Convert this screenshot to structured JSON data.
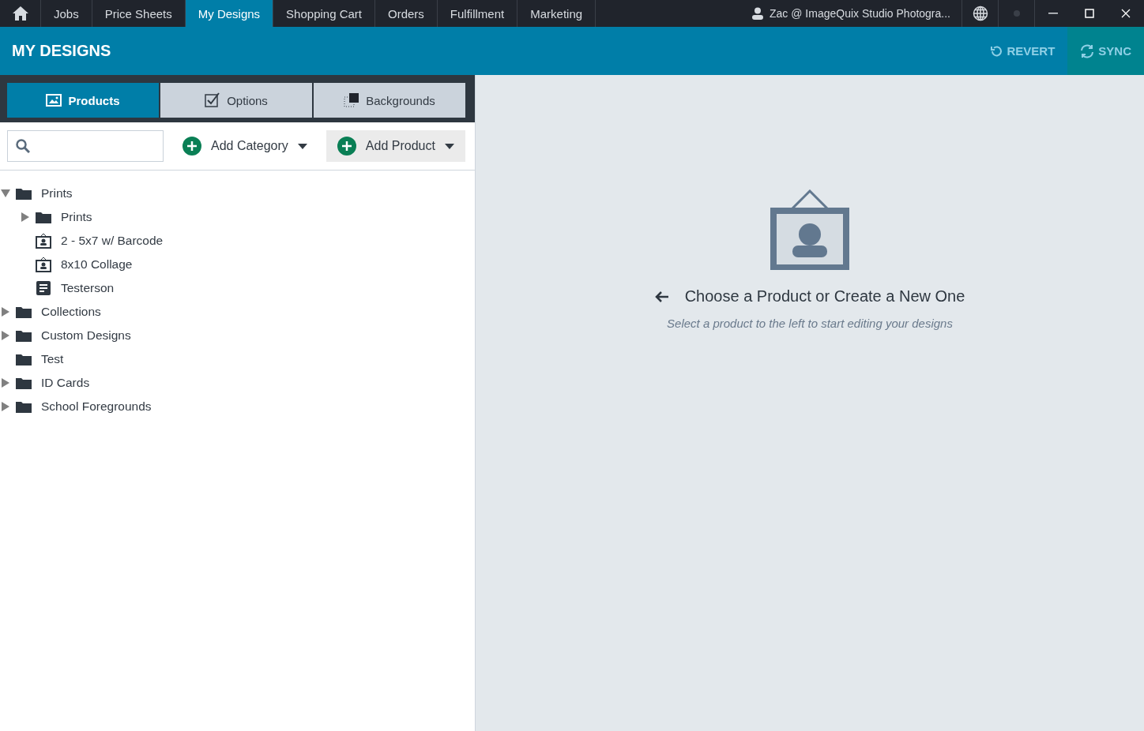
{
  "nav": {
    "tabs": [
      {
        "label": "Jobs",
        "selected": false
      },
      {
        "label": "Price Sheets",
        "selected": false
      },
      {
        "label": "My Designs",
        "selected": true
      },
      {
        "label": "Shopping Cart",
        "selected": false
      },
      {
        "label": "Orders",
        "selected": false
      },
      {
        "label": "Fulfillment",
        "selected": false
      },
      {
        "label": "Marketing",
        "selected": false
      }
    ],
    "user": "Zac @ ImageQuix Studio Photogra..."
  },
  "header": {
    "title": "MY DESIGNS",
    "actions": [
      {
        "kind": "revert",
        "label": "REVERT",
        "disabled": true
      },
      {
        "kind": "sync",
        "label": "SYNC",
        "disabled": true
      }
    ]
  },
  "panel_tabs": [
    {
      "kind": "products",
      "label": "Products",
      "selected": true
    },
    {
      "kind": "options",
      "label": "Options",
      "selected": false
    },
    {
      "kind": "backgrounds",
      "label": "Backgrounds",
      "selected": false
    }
  ],
  "toolbar": {
    "add_category": "Add Category",
    "add_product": "Add Product"
  },
  "tree": [
    {
      "kind": "folder",
      "label": "Prints",
      "expandable": true,
      "expanded": true,
      "children": [
        {
          "kind": "folder",
          "label": "Prints",
          "expandable": true,
          "expanded": false
        },
        {
          "kind": "product",
          "label": "2 - 5x7 w/ Barcode",
          "expandable": false
        },
        {
          "kind": "product",
          "label": "8x10 Collage",
          "expandable": false
        },
        {
          "kind": "document",
          "label": "Testerson",
          "expandable": false
        }
      ]
    },
    {
      "kind": "folder",
      "label": "Collections",
      "expandable": true,
      "expanded": false
    },
    {
      "kind": "folder",
      "label": "Custom Designs",
      "expandable": true,
      "expanded": false
    },
    {
      "kind": "folder",
      "label": "Test",
      "expandable": false
    },
    {
      "kind": "folder",
      "label": "ID Cards",
      "expandable": true,
      "expanded": false
    },
    {
      "kind": "folder",
      "label": "School Foregrounds",
      "expandable": true,
      "expanded": false
    }
  ],
  "empty_state": {
    "title": "Choose a Product or Create a New One",
    "subtitle": "Select a product to the left to start editing your designs"
  }
}
